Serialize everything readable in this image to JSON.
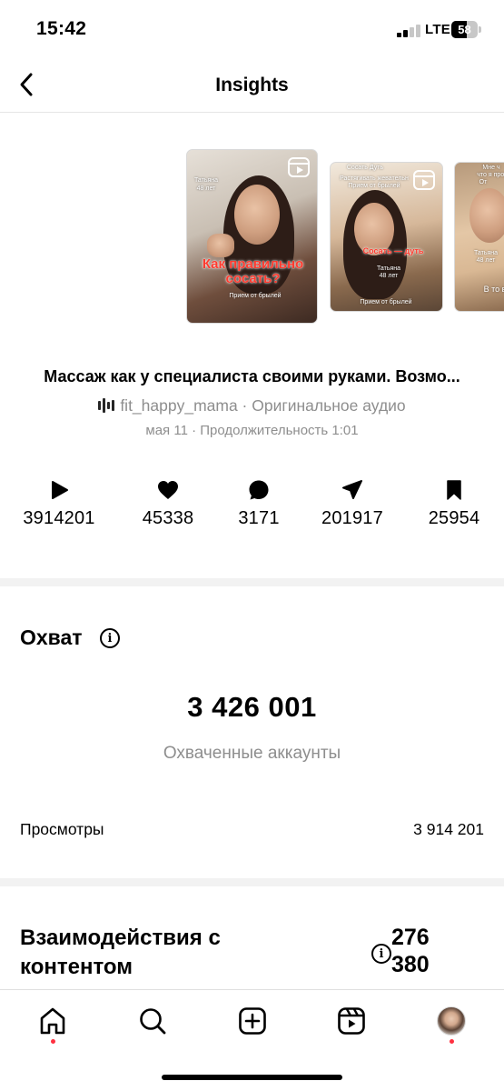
{
  "status_bar": {
    "time": "15:42",
    "network": "LTE",
    "battery": "58",
    "battery_level": 0.58,
    "signal_bars_active": 2
  },
  "header": {
    "title": "Insights",
    "back_icon": "chevron-left-icon"
  },
  "carousel": {
    "items": [
      {
        "name_label": "Татьяна",
        "age_label": "48 лет",
        "headline": "Как правильно сосать?",
        "subline": "Прием от брылей",
        "icon": "reels-icon"
      },
      {
        "top_label": "Сосать Дуть",
        "mid_label": "Растягивать жевательн",
        "sub_label": "Прием от брылей",
        "headline": "Сосать — дуть",
        "name_label": "Татьяна",
        "age_label": "48 лет",
        "bottom_label": "Прием от брылей",
        "icon": "reels-icon"
      },
      {
        "top_label": "Мне ч",
        "top_label2": "что я прос",
        "top_label3": "От",
        "name_label": "Татьяна",
        "age_label": "48 лет",
        "bottom_label": "В то в",
        "icon": "reels-icon"
      }
    ]
  },
  "post": {
    "caption": "Массаж как у специалиста своими руками. Возмо...",
    "author": "fit_happy_mama · Оригинальное аудио",
    "meta": "мая 11 · Продолжительность 1:01"
  },
  "stats": [
    {
      "icon": "play-icon",
      "value": "3914201"
    },
    {
      "icon": "heart-icon",
      "value": "45338"
    },
    {
      "icon": "comment-icon",
      "value": "3171"
    },
    {
      "icon": "share-icon",
      "value": "201917"
    },
    {
      "icon": "bookmark-icon",
      "value": "25954"
    }
  ],
  "reach": {
    "title": "Охват",
    "number": "3 426 001",
    "caption": "Охваченные аккаунты",
    "views_label": "Просмотры",
    "views_value": "3 914 201"
  },
  "interactions": {
    "title": "Взаимодействия с контентом",
    "value": "276 380"
  },
  "tab_bar": {
    "tabs": [
      "home-icon",
      "search-icon",
      "create-icon",
      "reels-icon",
      "profile-avatar"
    ]
  },
  "colors": {
    "text_primary": "#000000",
    "text_secondary": "#8e8e8e",
    "notification_dot": "#ff3040",
    "section_divider": "#f2f2f2"
  }
}
